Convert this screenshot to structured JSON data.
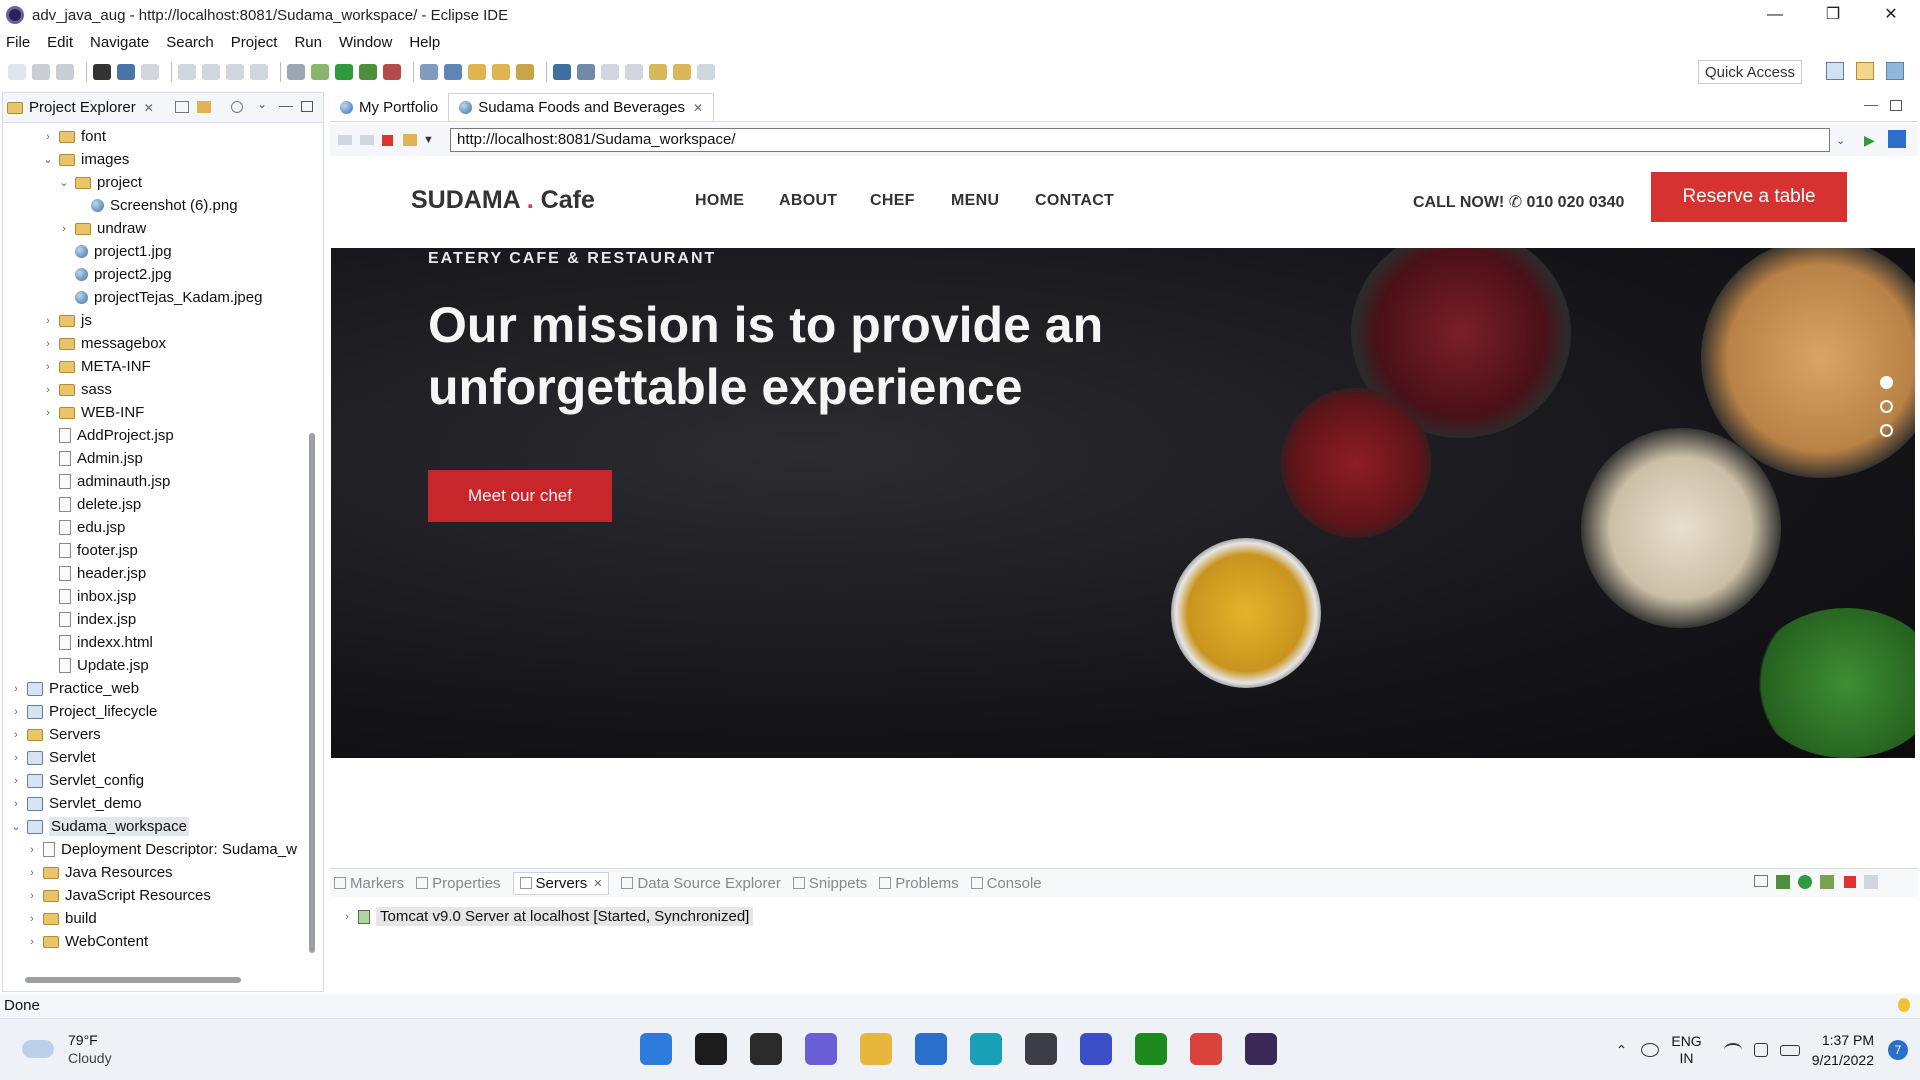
{
  "window": {
    "title": "adv_java_aug - http://localhost:8081/Sudama_workspace/ - Eclipse IDE",
    "controls": [
      "—",
      "❐",
      "✕"
    ]
  },
  "menu": [
    "File",
    "Edit",
    "Navigate",
    "Search",
    "Project",
    "Run",
    "Window",
    "Help"
  ],
  "toolbar": {
    "quick_access": "Quick Access"
  },
  "project_explorer": {
    "tab_label": "Project Explorer",
    "tree": [
      {
        "label": "font",
        "icon": "folder-icon",
        "indent": 3,
        "arrow": "›"
      },
      {
        "label": "images",
        "icon": "folder-icon",
        "indent": 3,
        "arrow": "⌄"
      },
      {
        "label": "project",
        "icon": "folder-icon",
        "indent": 4,
        "arrow": "⌄"
      },
      {
        "label": "Screenshot (6).png",
        "icon": "globe-icon",
        "indent": 5,
        "arrow": ""
      },
      {
        "label": "undraw",
        "icon": "folder-icon",
        "indent": 4,
        "arrow": "›"
      },
      {
        "label": "project1.jpg",
        "icon": "globe-icon",
        "indent": 4,
        "arrow": ""
      },
      {
        "label": "project2.jpg",
        "icon": "globe-icon",
        "indent": 4,
        "arrow": ""
      },
      {
        "label": "projectTejas_Kadam.jpeg",
        "icon": "globe-icon",
        "indent": 4,
        "arrow": ""
      },
      {
        "label": "js",
        "icon": "folder-icon",
        "indent": 3,
        "arrow": "›"
      },
      {
        "label": "messagebox",
        "icon": "folder-icon",
        "indent": 3,
        "arrow": "›"
      },
      {
        "label": "META-INF",
        "icon": "folder-icon",
        "indent": 3,
        "arrow": "›"
      },
      {
        "label": "sass",
        "icon": "folder-icon",
        "indent": 3,
        "arrow": "›"
      },
      {
        "label": "WEB-INF",
        "icon": "folder-icon",
        "indent": 3,
        "arrow": "›"
      },
      {
        "label": "AddProject.jsp",
        "icon": "file-icon",
        "indent": 3,
        "arrow": ""
      },
      {
        "label": "Admin.jsp",
        "icon": "file-icon",
        "indent": 3,
        "arrow": ""
      },
      {
        "label": "adminauth.jsp",
        "icon": "file-icon",
        "indent": 3,
        "arrow": ""
      },
      {
        "label": "delete.jsp",
        "icon": "file-icon",
        "indent": 3,
        "arrow": ""
      },
      {
        "label": "edu.jsp",
        "icon": "file-icon",
        "indent": 3,
        "arrow": ""
      },
      {
        "label": "footer.jsp",
        "icon": "file-icon",
        "indent": 3,
        "arrow": ""
      },
      {
        "label": "header.jsp",
        "icon": "file-icon",
        "indent": 3,
        "arrow": ""
      },
      {
        "label": "inbox.jsp",
        "icon": "file-icon",
        "indent": 3,
        "arrow": ""
      },
      {
        "label": "index.jsp",
        "icon": "file-icon",
        "indent": 3,
        "arrow": ""
      },
      {
        "label": "indexx.html",
        "icon": "file-icon",
        "indent": 3,
        "arrow": ""
      },
      {
        "label": "Update.jsp",
        "icon": "file-icon",
        "indent": 3,
        "arrow": ""
      },
      {
        "label": "Practice_web",
        "icon": "project-icon",
        "indent": 1,
        "arrow": "›"
      },
      {
        "label": "Project_lifecycle",
        "icon": "project-icon",
        "indent": 1,
        "arrow": "›"
      },
      {
        "label": "Servers",
        "icon": "folder-icon",
        "indent": 1,
        "arrow": "›"
      },
      {
        "label": "Servlet",
        "icon": "project-icon",
        "indent": 1,
        "arrow": "›"
      },
      {
        "label": "Servlet_config",
        "icon": "project-icon",
        "indent": 1,
        "arrow": "›"
      },
      {
        "label": "Servlet_demo",
        "icon": "project-icon",
        "indent": 1,
        "arrow": "›"
      },
      {
        "label": "Sudama_workspace",
        "icon": "project-icon",
        "indent": 1,
        "arrow": "⌄",
        "selected": true
      },
      {
        "label": "Deployment Descriptor: Sudama_w",
        "icon": "file-icon",
        "indent": 2,
        "arrow": "›"
      },
      {
        "label": "Java Resources",
        "icon": "folder-icon",
        "indent": 2,
        "arrow": "›"
      },
      {
        "label": "JavaScript Resources",
        "icon": "folder-icon",
        "indent": 2,
        "arrow": "›"
      },
      {
        "label": "build",
        "icon": "folder-icon",
        "indent": 2,
        "arrow": "›"
      },
      {
        "label": "WebContent",
        "icon": "folder-icon",
        "indent": 2,
        "arrow": "›"
      }
    ]
  },
  "editor": {
    "tabs": [
      {
        "label": "My Portfolio",
        "active": false
      },
      {
        "label": "Sudama Foods and Beverages",
        "active": true
      }
    ],
    "url": "http://localhost:8081/Sudama_workspace/"
  },
  "site": {
    "brand": "SUDAMA",
    "brand_dot": ".",
    "brand_suffix": "Cafe",
    "nav": [
      "HOME",
      "ABOUT",
      "CHEF",
      "MENU",
      "CONTACT"
    ],
    "call": "CALL NOW! ✆ 010 020 0340",
    "reserve": "Reserve a table",
    "hero_kicker": "EATERY CAFE & RESTAURANT",
    "hero_title": "Our mission is to provide an unforgettable experience",
    "hero_cta": "Meet our chef",
    "slide_count": 3,
    "active_slide": 1
  },
  "bottom_panel": {
    "tabs": [
      {
        "label": "Markers",
        "active": false
      },
      {
        "label": "Properties",
        "active": false
      },
      {
        "label": "Servers",
        "active": true
      },
      {
        "label": "Data Source Explorer",
        "active": false
      },
      {
        "label": "Snippets",
        "active": false
      },
      {
        "label": "Problems",
        "active": false
      },
      {
        "label": "Console",
        "active": false
      }
    ],
    "server": "Tomcat v9.0 Server at localhost  [Started, Synchronized]"
  },
  "status": "Done",
  "taskbar": {
    "weather_temp": "79°F",
    "weather_cond": "Cloudy",
    "lang1": "ENG",
    "lang2": "IN",
    "time": "1:37 PM",
    "date": "9/21/2022",
    "notifications": "7",
    "icons": [
      "start-icon",
      "search-icon",
      "task-view-icon",
      "chat-icon",
      "file-explorer-icon",
      "store-icon",
      "edge-icon",
      "app-icon",
      "app-icon-2",
      "xbox-icon",
      "chrome-icon",
      "eclipse-icon"
    ],
    "icon_colors": [
      "#2f7bdc",
      "#1c1c1c",
      "#2a2a2a",
      "#6b5fd6",
      "#e7b63c",
      "#2a6fc9",
      "#1aa0b6",
      "#3d3d48",
      "#3b4ec7",
      "#1e8a1e",
      "#d9443a",
      "#3a2a5a"
    ]
  },
  "colors": {
    "accent": "#d63232",
    "hero_bg": "#16161a"
  }
}
